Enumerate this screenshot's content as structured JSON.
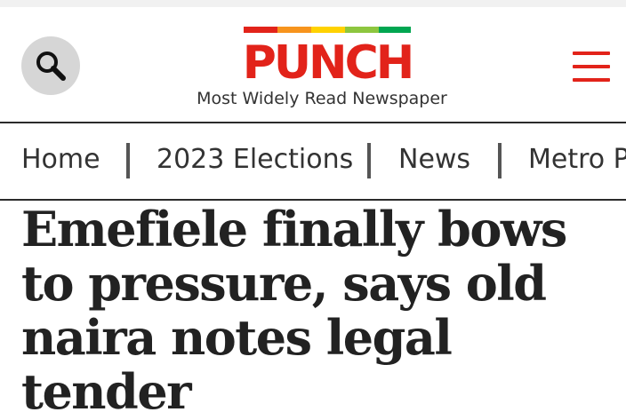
{
  "header": {
    "search_icon": "search-icon",
    "logo_text": "PUNCH",
    "logo_colors": [
      "#e2231a",
      "#f7941d",
      "#ffd200",
      "#8dc63f",
      "#00a651"
    ],
    "tagline": "Most Widely Read Newspaper",
    "menu_icon": "hamburger-menu-icon",
    "accent_color": "#e2231a"
  },
  "nav": {
    "items": [
      {
        "label": "Home"
      },
      {
        "label": "2023 Elections"
      },
      {
        "label": "News"
      },
      {
        "label": "Metro Plus"
      }
    ]
  },
  "article": {
    "headline": "Emefiele finally bows to pressure, says old naira notes legal tender"
  }
}
